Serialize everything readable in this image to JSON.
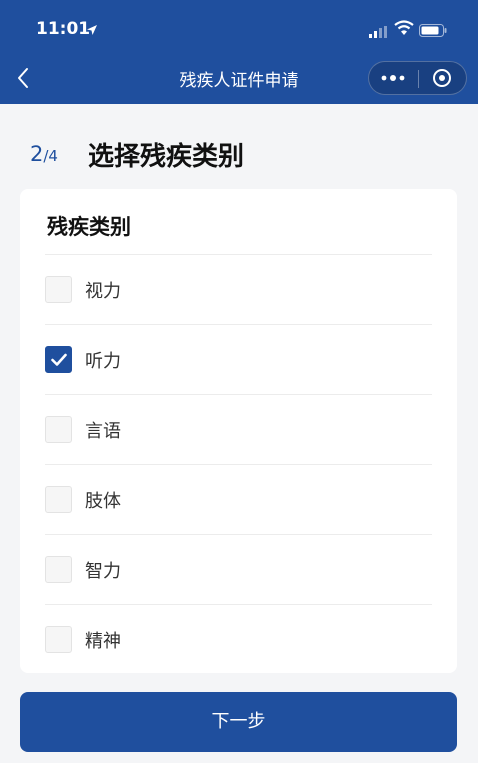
{
  "status_bar": {
    "time": "11:01",
    "icons": [
      "location-arrow-icon",
      "signal-icon",
      "wifi-icon",
      "battery-icon"
    ]
  },
  "nav": {
    "title": "残疾人证件申请",
    "back_icon": "chevron-left-icon",
    "more_icon": "more-dots-icon",
    "close_icon": "target-close-icon"
  },
  "step": {
    "current": "2",
    "total": "/4",
    "title": "选择残疾类别"
  },
  "card": {
    "title": "残疾类别",
    "options": [
      {
        "label": "视力",
        "checked": false
      },
      {
        "label": "听力",
        "checked": true
      },
      {
        "label": "言语",
        "checked": false
      },
      {
        "label": "肢体",
        "checked": false
      },
      {
        "label": "智力",
        "checked": false
      },
      {
        "label": "精神",
        "checked": false
      }
    ]
  },
  "footer": {
    "next_label": "下一步"
  },
  "colors": {
    "primary": "#1f4f9e",
    "background": "#f4f5f7",
    "card": "#ffffff"
  }
}
